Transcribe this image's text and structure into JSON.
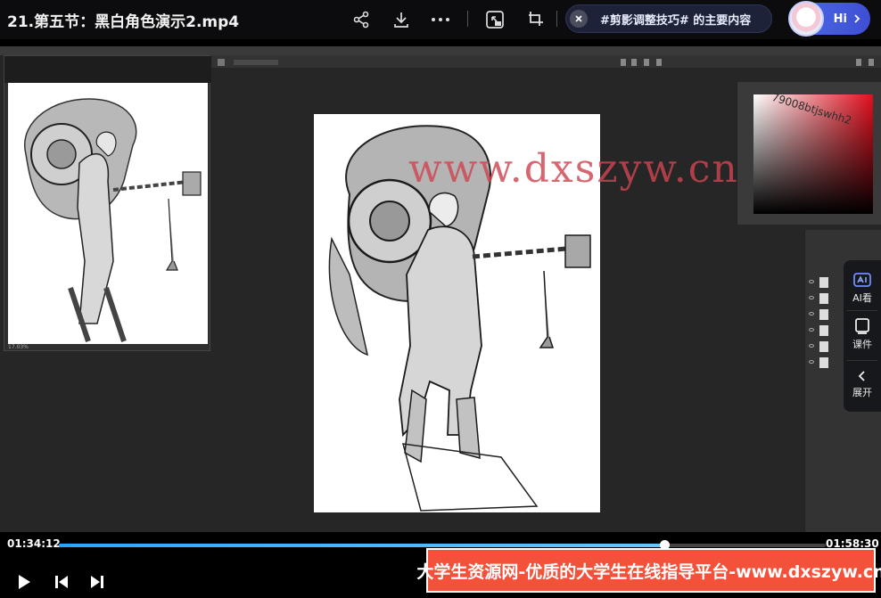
{
  "header": {
    "title": "21.第五节：黑白角色演示2.mp4",
    "icons": [
      "share-icon",
      "download-icon",
      "more-icon",
      "picture-in-picture-icon",
      "fullscreen-icon"
    ],
    "tag_pill": {
      "text": "#剪影调整技巧# 的主要内容"
    },
    "assistant": {
      "label": "Hi"
    }
  },
  "video": {
    "watermark": "www.dxszyw.cn",
    "color_picker_overlay": "79008btjswhh2",
    "navigator_footer": "17.03%"
  },
  "side_tools": {
    "items": [
      {
        "label": "AI看",
        "icon": "ai-view-icon"
      },
      {
        "label": "课件",
        "icon": "courseware-icon"
      },
      {
        "label": "展开",
        "icon": "expand-left-icon"
      }
    ]
  },
  "player": {
    "current_time": "01:34:12",
    "total_time": "01:58:30",
    "progress": 0.79
  },
  "banner": {
    "text": "大学生资源网-优质的大学生在线指导平台-www.dxszyw.cn"
  },
  "colors": {
    "accent": "#2aa5ff",
    "banner_bg": "#f4513b",
    "watermark": "#cd4650"
  }
}
